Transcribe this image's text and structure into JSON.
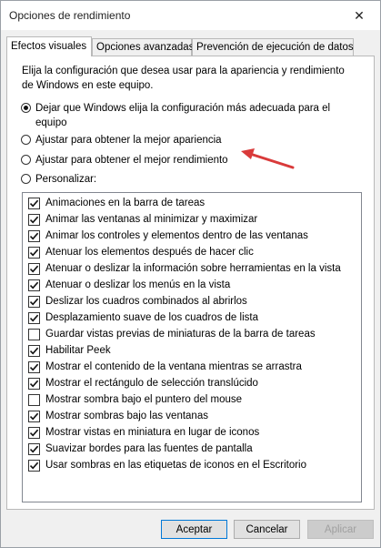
{
  "window": {
    "title": "Opciones de rendimiento",
    "close_glyph": "✕"
  },
  "tabs": [
    {
      "label": "Efectos visuales",
      "active": true
    },
    {
      "label": "Opciones avanzadas",
      "active": false
    },
    {
      "label": "Prevención de ejecución de datos",
      "active": false
    }
  ],
  "description": "Elija la configuración que desea usar para la apariencia y rendimiento de Windows en este equipo.",
  "radios": [
    {
      "label": "Dejar que Windows elija la configuración más adecuada para el equipo",
      "selected": true
    },
    {
      "label": "Ajustar para obtener la mejor apariencia",
      "selected": false
    },
    {
      "label": "Ajustar para obtener el mejor rendimiento",
      "selected": false
    },
    {
      "label": "Personalizar:",
      "selected": false
    }
  ],
  "effects": [
    {
      "label": "Animaciones en la barra de tareas",
      "checked": true
    },
    {
      "label": "Animar las ventanas al minimizar y maximizar",
      "checked": true
    },
    {
      "label": "Animar los controles y elementos dentro de las ventanas",
      "checked": true
    },
    {
      "label": "Atenuar los elementos después de hacer clic",
      "checked": true
    },
    {
      "label": "Atenuar o deslizar la información sobre herramientas en la vista",
      "checked": true
    },
    {
      "label": "Atenuar o deslizar los menús en la vista",
      "checked": true
    },
    {
      "label": "Deslizar los cuadros combinados al abrirlos",
      "checked": true
    },
    {
      "label": "Desplazamiento suave de los cuadros de lista",
      "checked": true
    },
    {
      "label": "Guardar vistas previas de miniaturas de la barra de tareas",
      "checked": false
    },
    {
      "label": "Habilitar Peek",
      "checked": true
    },
    {
      "label": "Mostrar el contenido de la ventana mientras se arrastra",
      "checked": true
    },
    {
      "label": "Mostrar el rectángulo de selección translúcido",
      "checked": true
    },
    {
      "label": "Mostrar sombra bajo el puntero del mouse",
      "checked": false
    },
    {
      "label": "Mostrar sombras bajo las ventanas",
      "checked": true
    },
    {
      "label": "Mostrar vistas en miniatura en lugar de iconos",
      "checked": true
    },
    {
      "label": "Suavizar bordes para las fuentes de pantalla",
      "checked": true
    },
    {
      "label": "Usar sombras en las etiquetas de iconos en el Escritorio",
      "checked": true
    }
  ],
  "buttons": {
    "accept": "Aceptar",
    "cancel": "Cancelar",
    "apply": "Aplicar"
  },
  "colors": {
    "annotation_arrow": "#d93a3a",
    "focus_border": "#0078d7"
  },
  "icons": {
    "close": "close-icon",
    "annotation": "red-arrow-icon"
  }
}
